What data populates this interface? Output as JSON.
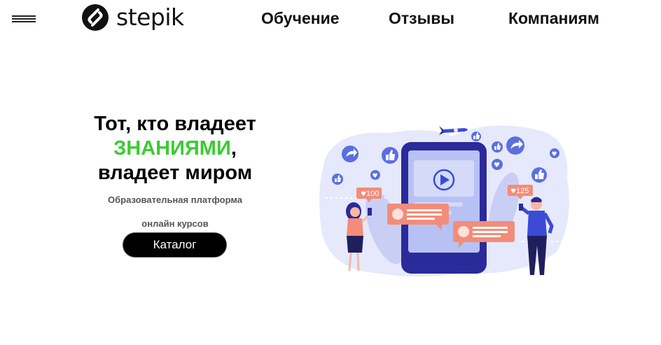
{
  "header": {
    "logo_text": "stepik",
    "nav": [
      {
        "label": "Обучение"
      },
      {
        "label": "Отзывы"
      },
      {
        "label": "Компаниям"
      }
    ]
  },
  "hero": {
    "title_line1": "Тот, кто владеет",
    "title_accent": "ЗНАНИЯМИ",
    "title_comma": ",",
    "title_line3": "владеет миром",
    "subtitle_line1": "Образовательная платформа",
    "subtitle_line2": "онлайн курсов",
    "cta_label": "Каталог"
  },
  "illustration": {
    "badge_left": "100",
    "badge_right": "125"
  },
  "colors": {
    "accent_green": "#3ccb32",
    "phone_navy": "#2a2a9a",
    "bubble_coral": "#f38c7a",
    "icon_blue": "#5b6fe0",
    "blob_lavender": "#e6e9fb"
  }
}
